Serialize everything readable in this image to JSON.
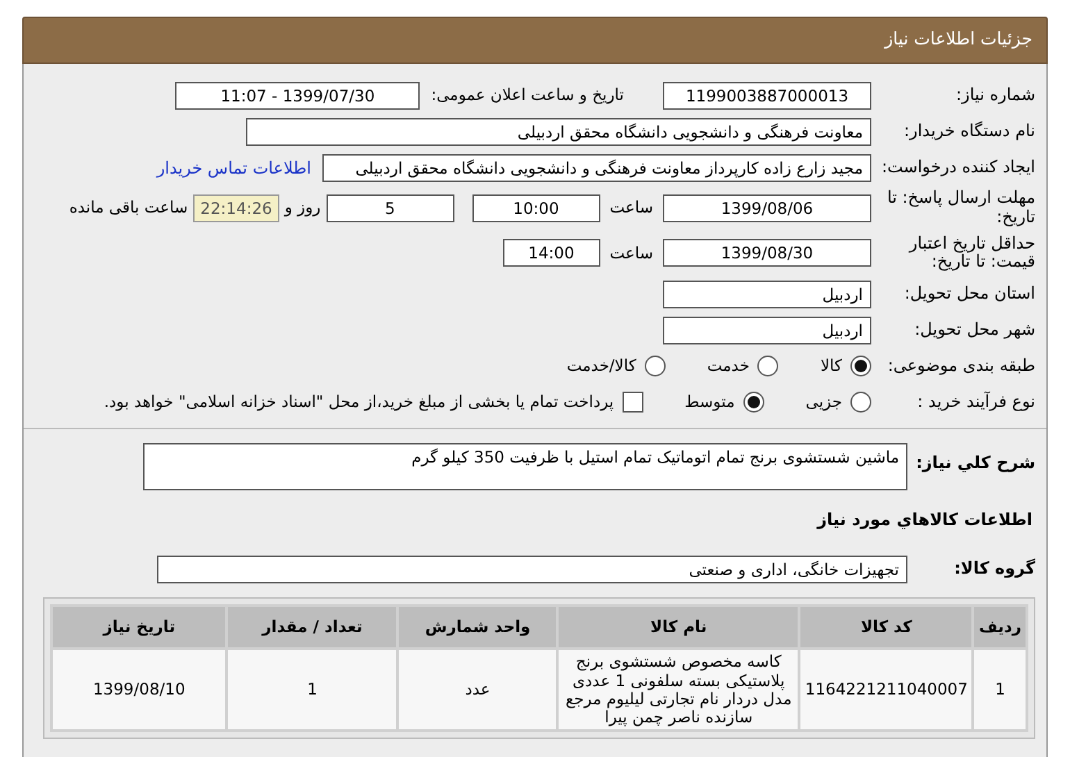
{
  "header": {
    "title": "جزئیات اطلاعات نیاز"
  },
  "need_number": {
    "label": "شماره نیاز:",
    "value": "1199003887000013"
  },
  "announce": {
    "label": "تاریخ و ساعت اعلان عمومی:",
    "value": "1399/07/30 - 11:07"
  },
  "buyer": {
    "label": "نام دستگاه خریدار:",
    "value": "معاونت فرهنگی و دانشجویی دانشگاه محقق اردبیلی"
  },
  "requester": {
    "label": "ایجاد کننده درخواست:",
    "value": "مجید زارع زاده کارپرداز معاونت فرهنگی و دانشجویی دانشگاه محقق اردبیلی",
    "link": "اطلاعات تماس خریدار"
  },
  "deadline": {
    "label": "مهلت ارسال پاسخ: تا تاریخ:",
    "date": "1399/08/06",
    "time_label": "ساعت",
    "time": "10:00",
    "days": "5",
    "days_label": "روز و",
    "remaining": "22:14:26",
    "remaining_label": "ساعت باقی مانده"
  },
  "validity": {
    "label": "حداقل تاریخ اعتبار قیمت: تا تاریخ:",
    "date": "1399/08/30",
    "time_label": "ساعت",
    "time": "14:00"
  },
  "province": {
    "label": "استان محل تحویل:",
    "value": "اردبیل"
  },
  "city": {
    "label": "شهر محل تحویل:",
    "value": "اردبیل"
  },
  "category": {
    "label": "طبقه بندی موضوعی:",
    "options": [
      {
        "label": "کالا",
        "selected": true
      },
      {
        "label": "خدمت",
        "selected": false
      },
      {
        "label": "کالا/خدمت",
        "selected": false
      }
    ]
  },
  "process": {
    "label": "نوع فرآیند خرید :",
    "options": [
      {
        "label": "جزیی",
        "selected": false
      },
      {
        "label": "متوسط",
        "selected": true
      }
    ],
    "checkbox": {
      "label": "پرداخت تمام یا بخشی از مبلغ خرید،از محل \"اسناد خزانه اسلامی\" خواهد بود.",
      "checked": false
    }
  },
  "description": {
    "label": "شرح كلي نياز:",
    "value": "ماشین شستشوی برنج تمام اتوماتیک تمام استیل با ظرفیت 350 کیلو گرم"
  },
  "goods_section": {
    "title": "اطلاعات كالاهاي مورد نياز"
  },
  "goods_group": {
    "label": "گروه کالا:",
    "value": "تجهیزات خانگی، اداری و صنعتی"
  },
  "table": {
    "columns": [
      "ردیف",
      "کد کالا",
      "نام کالا",
      "واحد شمارش",
      "تعداد / مقدار",
      "تاریخ نیاز"
    ],
    "rows": [
      [
        "1",
        "1164221211040007",
        "کاسه مخصوص شستشوی برنج پلاستیکی بسته سلفونی 1 عددی مدل دردار نام تجارتی لیلیوم مرجع سازنده ناصر چمن پیرا",
        "عدد",
        "1",
        "1399/08/10"
      ]
    ]
  }
}
